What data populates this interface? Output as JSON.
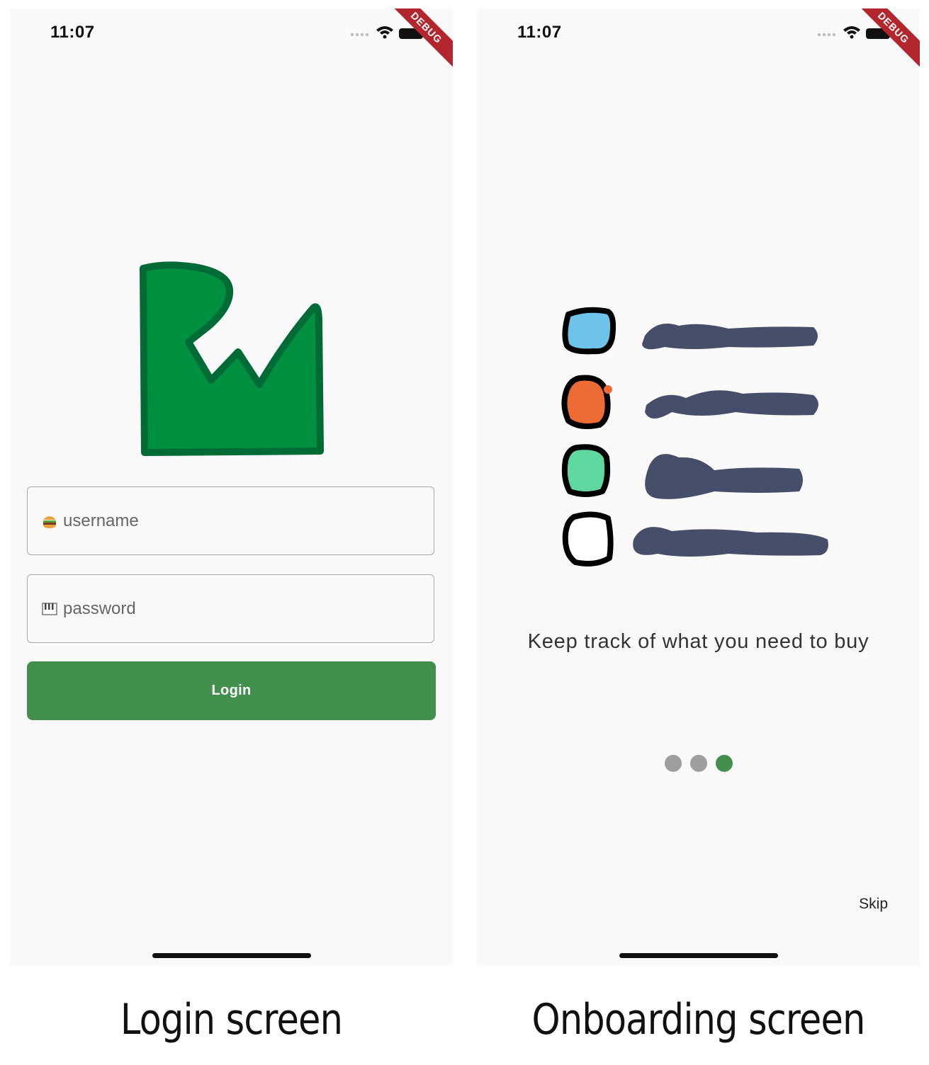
{
  "login_screen": {
    "status_time": "11:07",
    "debug_banner": "DEBUG",
    "username_placeholder": "username",
    "username_icon": "burger-icon",
    "password_placeholder": "password",
    "password_icon": "piano-keys-icon",
    "login_label": "Login",
    "brand_color": "#43904e",
    "logo_color": "#00903f"
  },
  "onboarding_screen": {
    "status_time": "11:07",
    "debug_banner": "DEBUG",
    "message": "Keep track of what you need to buy",
    "skip_label": "Skip",
    "page_indicator": {
      "total": 3,
      "active": 3
    },
    "checklist_colors": [
      "#6ec3ea",
      "#ef6b36",
      "#5fd8a0",
      "#ffffff"
    ]
  },
  "captions": {
    "login": "Login screen",
    "onboarding": "Onboarding screen"
  }
}
